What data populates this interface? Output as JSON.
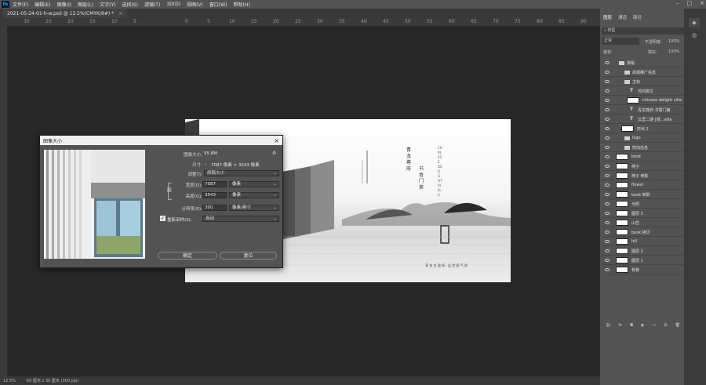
{
  "app": {
    "icon_text": "Ps",
    "menu": [
      "文件(F)",
      "编辑(E)",
      "图像(I)",
      "图层(L)",
      "文字(Y)",
      "选择(S)",
      "滤镜(T)",
      "3D(D)",
      "视图(V)",
      "窗口(W)",
      "帮助(H)"
    ]
  },
  "doc_tab": {
    "title": "2021-05-24-01-h-w.psd @ 12.5%(CMYK/8#) *",
    "close": "×"
  },
  "ruler": {
    "h_ticks": [
      "30",
      "25",
      "20",
      "15",
      "10",
      "5",
      "0",
      "5",
      "10",
      "15",
      "20",
      "25",
      "30",
      "35",
      "40",
      "45",
      "50",
      "55",
      "60",
      "65",
      "70",
      "75",
      "80",
      "85",
      "90"
    ]
  },
  "status": {
    "zoom": "12.5%",
    "size": "60 厘米 x 30 厘米 (300 ppi)"
  },
  "dialog": {
    "title": "图像大小",
    "close": "×",
    "image_size_label": "图像大小:",
    "image_size_value": "95.8M",
    "dimensions_label": "尺寸:",
    "dimensions_value": "7087 像素 × 3543 像素",
    "fit_label": "调整为:",
    "fit_value": "原稿大小",
    "width_label": "宽度(D):",
    "width_value": "7087",
    "width_unit": "像素",
    "height_label": "高度(G):",
    "height_value": "3543",
    "height_unit": "像素",
    "resolution_label": "分辨率(R):",
    "resolution_value": "300",
    "resolution_unit": "像素/英寸",
    "resample_label": "重新采样(S):",
    "resample_checked": true,
    "resample_value": "自动",
    "ok_label": "确定",
    "cancel_label": "复位"
  },
  "artwork": {
    "brand_cn": "青龙尊府",
    "sub_cn": "书香门第",
    "brand_en": "CHINESE DELIGHT VILLA",
    "footer_cn": "享 东 方 居 所 · 品 世 家 气 质"
  },
  "panel": {
    "tabs": [
      "图层",
      "通道",
      "路径"
    ],
    "search_placeholder": "类型",
    "blend_mode": "正常",
    "opacity_label": "不透明度:",
    "opacity_value": "100%",
    "lock_label": "锁定:",
    "fill_label": "填充:",
    "fill_value": "100%",
    "layers": [
      {
        "name": "排版",
        "type": "folder",
        "indent": 0
      },
      {
        "name": "高端推广信息",
        "type": "folder",
        "indent": 1
      },
      {
        "name": "主标",
        "type": "folder",
        "indent": 1
      },
      {
        "name": "鸿鸿篇文",
        "type": "text",
        "indent": 2
      },
      {
        "name": "chinese delight villa",
        "type": "image",
        "indent": 2
      },
      {
        "name": "青龙尊府·书香门第",
        "type": "text",
        "indent": 2
      },
      {
        "name": "云里二期 [城...villa",
        "type": "text",
        "indent": 2
      },
      {
        "name": "形状 2",
        "type": "image",
        "indent": 1
      },
      {
        "name": "logo",
        "type": "folder",
        "indent": 1
      },
      {
        "name": "附加信息",
        "type": "folder",
        "indent": 1
      },
      {
        "name": "book",
        "type": "image",
        "indent": 0
      },
      {
        "name": "椅子",
        "type": "image",
        "indent": 0
      },
      {
        "name": "椅子 倒影",
        "type": "image",
        "indent": 0
      },
      {
        "name": "flower",
        "type": "image",
        "indent": 0
      },
      {
        "name": "book 倒影",
        "type": "image",
        "indent": 0
      },
      {
        "name": "光照",
        "type": "image",
        "indent": 0
      },
      {
        "name": "图层 3",
        "type": "image",
        "indent": 0
      },
      {
        "name": "山峦",
        "type": "image",
        "indent": 0
      },
      {
        "name": "book 拷贝",
        "type": "image",
        "indent": 0
      },
      {
        "name": "hill",
        "type": "image",
        "indent": 0
      },
      {
        "name": "图层 2",
        "type": "image",
        "indent": 0
      },
      {
        "name": "图层 1",
        "type": "image",
        "indent": 0
      },
      {
        "name": "背景",
        "type": "image",
        "indent": 0
      }
    ]
  }
}
